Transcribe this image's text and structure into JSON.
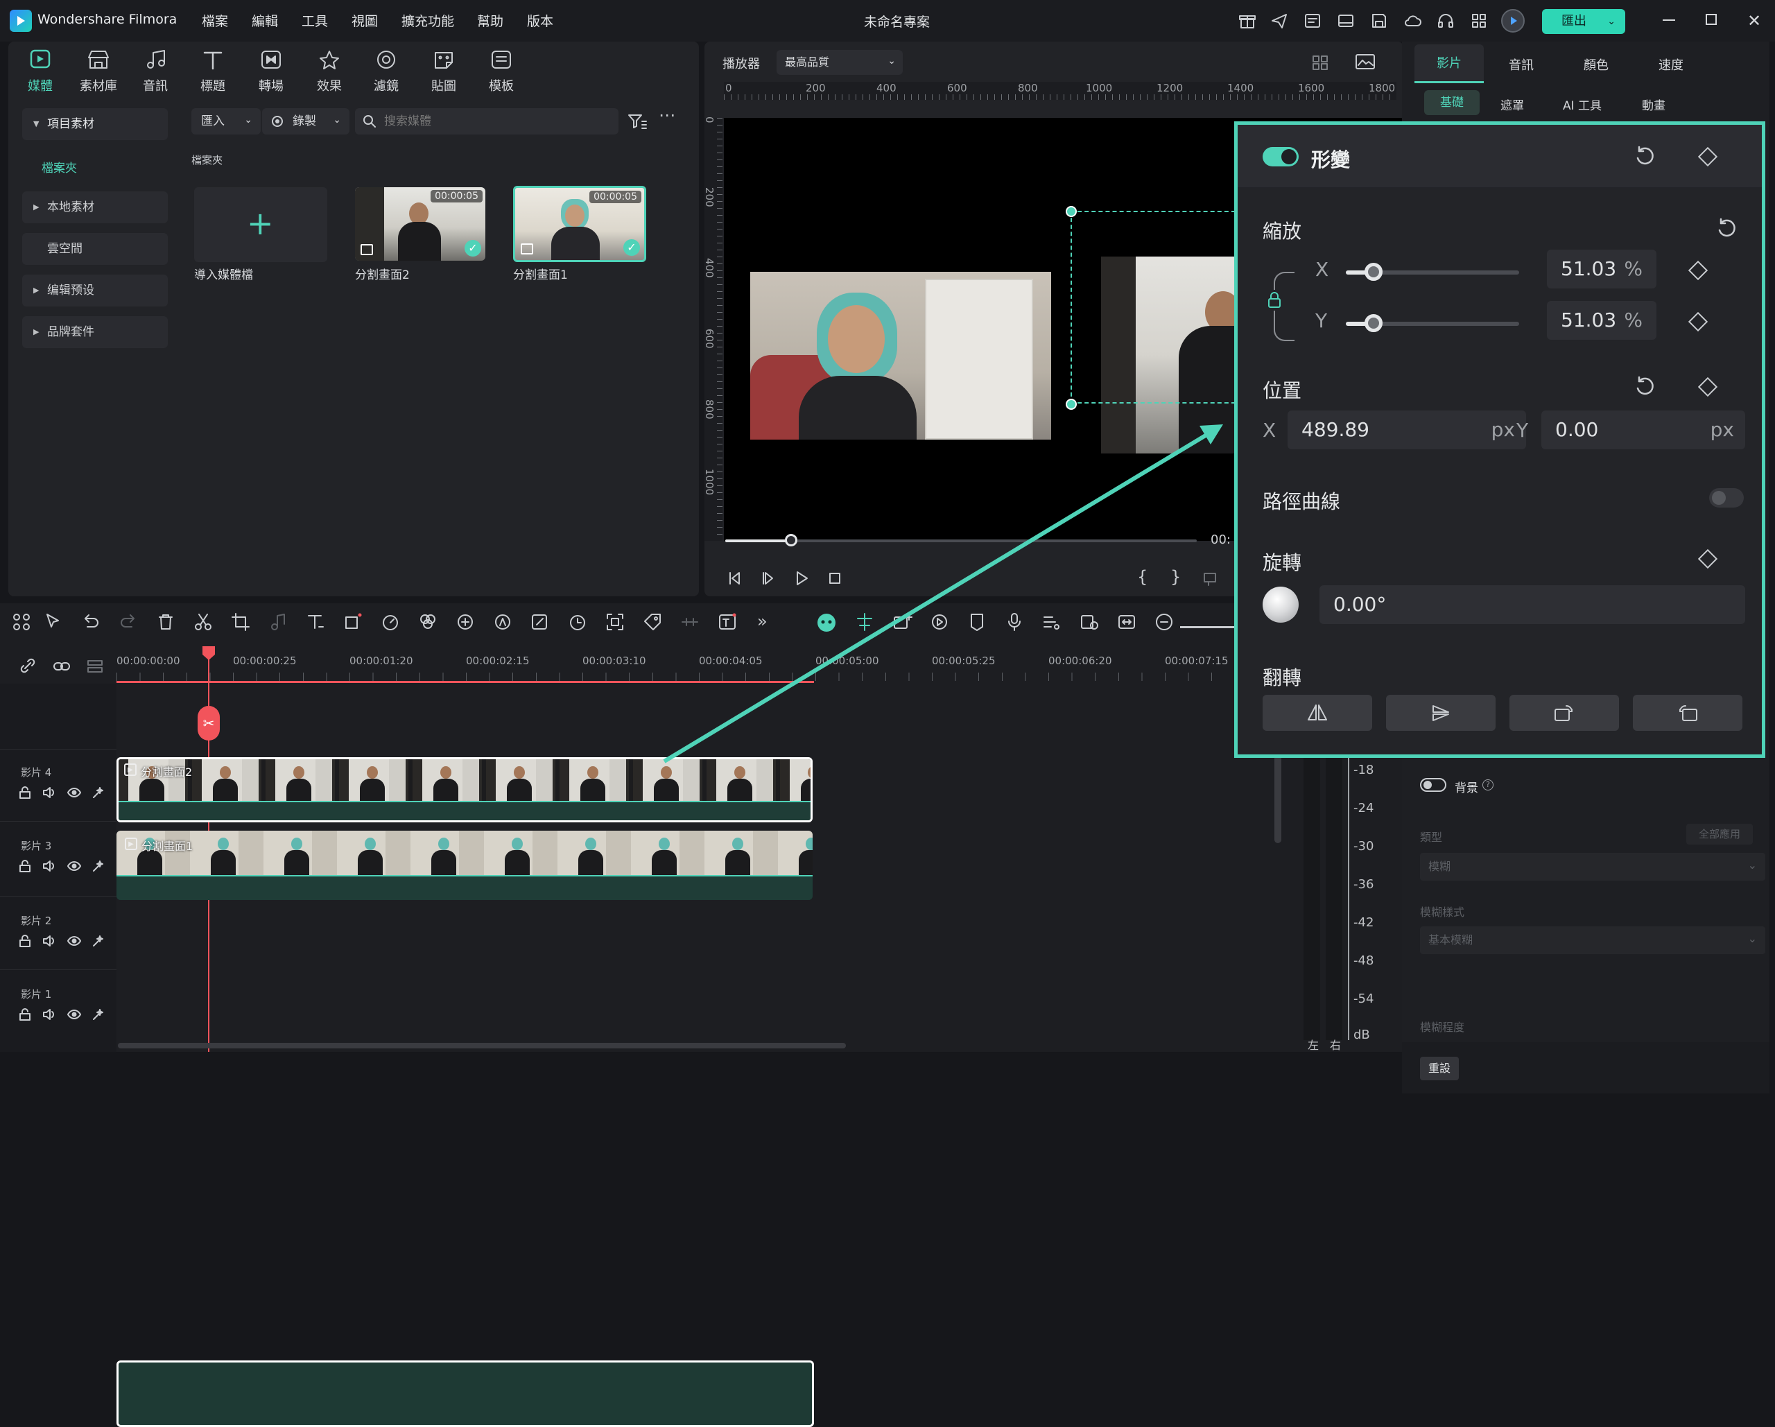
{
  "app": {
    "name": "Wondershare Filmora",
    "project_title": "未命名專案",
    "export_label": "匯出"
  },
  "menu": [
    "檔案",
    "編輯",
    "工具",
    "視圖",
    "擴充功能",
    "幫助",
    "版本"
  ],
  "media_tabs": [
    "媒體",
    "素材庫",
    "音訊",
    "標題",
    "轉場",
    "效果",
    "濾鏡",
    "貼圖",
    "模板"
  ],
  "media_sidebar": {
    "project_media": "項目素材",
    "folder": "檔案夾",
    "local": "本地素材",
    "cloud": "雲空間",
    "presets": "编辑预设",
    "brand": "品牌套件"
  },
  "media_toolbar": {
    "import": "匯入",
    "record": "錄製",
    "search_placeholder": "搜索媒體"
  },
  "media_grid": {
    "folder_label": "檔案夾",
    "import_label": "導入媒體檔",
    "clips": [
      {
        "name": "分割畫面2",
        "duration": "00:00:05"
      },
      {
        "name": "分割畫面1",
        "duration": "00:00:05"
      }
    ]
  },
  "player": {
    "label": "播放器",
    "quality": "最高品質",
    "h_ruler": [
      "0",
      "200",
      "400",
      "600",
      "800",
      "1000",
      "1200",
      "1400",
      "1600",
      "1800"
    ],
    "v_ruler": [
      "0",
      "200",
      "400",
      "600",
      "800",
      "1000"
    ],
    "time_partial": "00:",
    "scrub_progress": 0.14
  },
  "props": {
    "tabs": [
      "影片",
      "音訊",
      "顏色",
      "速度"
    ],
    "subtabs": [
      "基礎",
      "遮罩",
      "AI 工具",
      "動畫"
    ],
    "bg_label": "背景",
    "type_label": "類型",
    "apply_all": "全部應用",
    "type_value": "模糊",
    "blur_style_label": "模糊樣式",
    "blur_style_value": "基本模糊",
    "blur_level_label": "模糊程度",
    "reset": "重設"
  },
  "transform": {
    "title": "形變",
    "enabled": true,
    "scale_label": "縮放",
    "scale_x_label": "X",
    "scale_y_label": "Y",
    "scale_x": "51.03",
    "scale_y": "51.03",
    "scale_unit": "%",
    "scale_slider_fraction": 0.16,
    "position_label": "位置",
    "pos_x_label": "X",
    "pos_y_label": "Y",
    "pos_x": "489.89",
    "pos_y": "0.00",
    "pos_unit": "px",
    "path_curve_label": "路徑曲線",
    "rotate_label": "旋轉",
    "rotate_value": "0.00°",
    "flip_label": "翻轉"
  },
  "timeline": {
    "ruler": [
      "00:00:00:00",
      "00:00:00:25",
      "00:00:01:20",
      "00:00:02:15",
      "00:00:03:10",
      "00:00:04:05",
      "00:00:05:00",
      "00:00:05:25",
      "00:00:06:20",
      "00:00:07:15"
    ],
    "tracks": [
      {
        "name": "影片 4",
        "clip": "分割畫面2"
      },
      {
        "name": "影片 3",
        "clip": "分割畫面1"
      },
      {
        "name": "影片 2"
      },
      {
        "name": "影片 1"
      }
    ]
  },
  "meter": {
    "scale": [
      "-18",
      "-24",
      "-30",
      "-36",
      "-42",
      "-48",
      "-54",
      "dB"
    ],
    "left": "左",
    "right": "右"
  },
  "colors": {
    "accent": "#4fd3b8",
    "playhead": "#f2545b",
    "export": "#2ed6b5"
  }
}
